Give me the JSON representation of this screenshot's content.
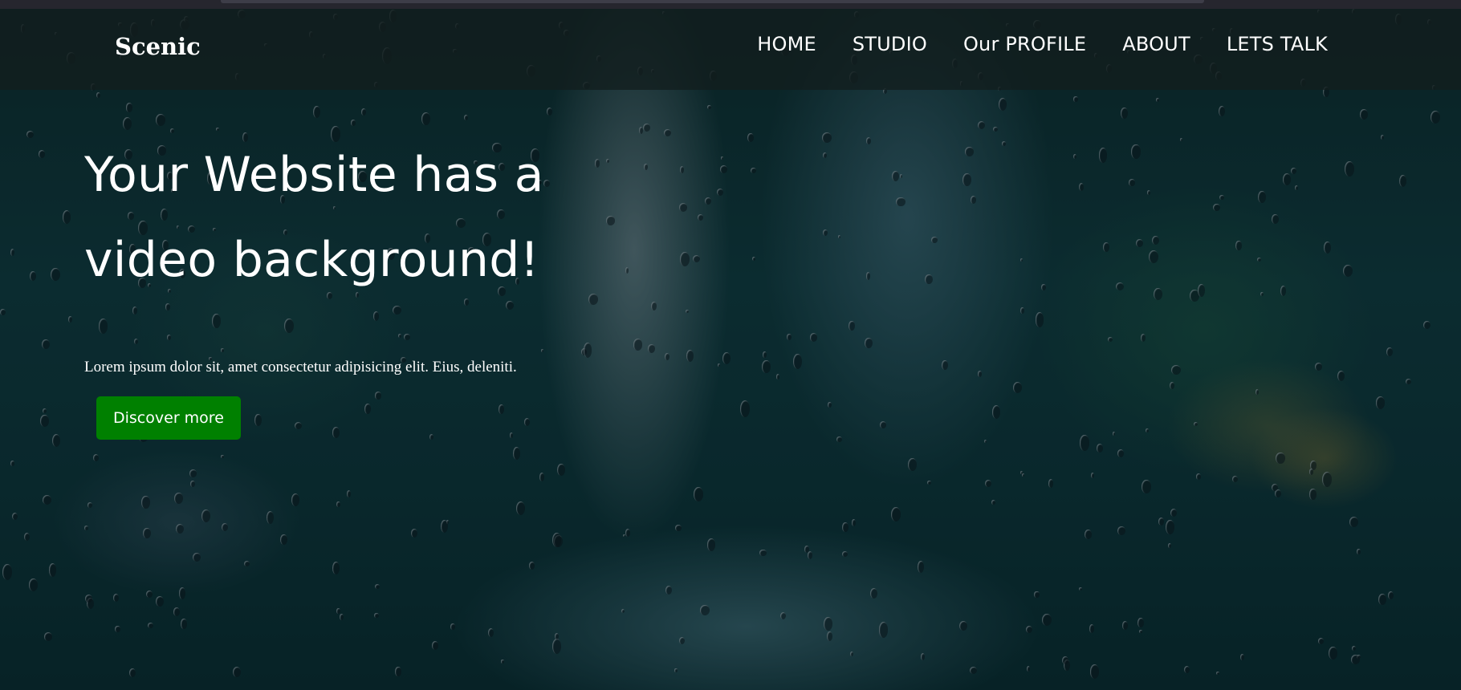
{
  "nav": {
    "logo": "Scenic",
    "links": [
      {
        "label": "HOME"
      },
      {
        "label": "STUDIO"
      },
      {
        "label": "Our PROFILE"
      },
      {
        "label": "ABOUT"
      },
      {
        "label": "LETS TALK"
      }
    ]
  },
  "hero": {
    "title": "Your Website has a video background!",
    "text": "Lorem ipsum dolor sit, amet consectetur adipisicing elit. Eius, deleniti.",
    "button_label": "Discover more",
    "background": "rainy-window-video-background"
  },
  "colors": {
    "button": "#008000",
    "nav_bg": "#121e1e",
    "text": "#ffffff"
  }
}
